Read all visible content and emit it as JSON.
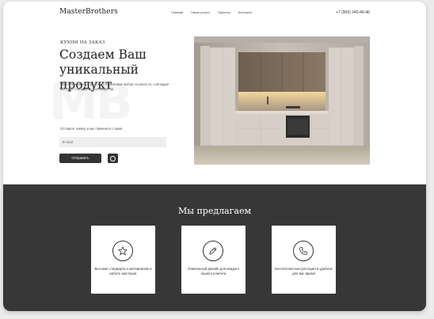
{
  "header": {
    "logo": "MasterBrothers",
    "nav": [
      "Главная",
      "Наши услуги",
      "Проекты",
      "Контакты"
    ],
    "phone": "+7 (905) 240-46-46"
  },
  "hero": {
    "watermark": "MB",
    "eyebrow": "КУХНИ НА ЗАКАЗ",
    "title": "Создаем Ваш уникальный продукт",
    "description": "Многолетний опыт работы с проектами любой сложности, соблюдая высокие стандарты производства.",
    "hint": "Оставьте заявку и мы свяжемся с вами",
    "email_placeholder": "E-mail",
    "submit_label": "Отправить"
  },
  "offer": {
    "title": "Мы предлагаем",
    "cards": [
      {
        "icon": "star-icon",
        "text": "Высокие стандарты к материалам и работе мастеров"
      },
      {
        "icon": "pencil-icon",
        "text": "Уникальный дизайн для каждого нашего клиента"
      },
      {
        "icon": "phone-icon",
        "text": "Бесплатная консультация в удобное для вас время"
      }
    ]
  },
  "colors": {
    "dark": "#373737",
    "accent": "#333333",
    "background": "#ffffff"
  }
}
